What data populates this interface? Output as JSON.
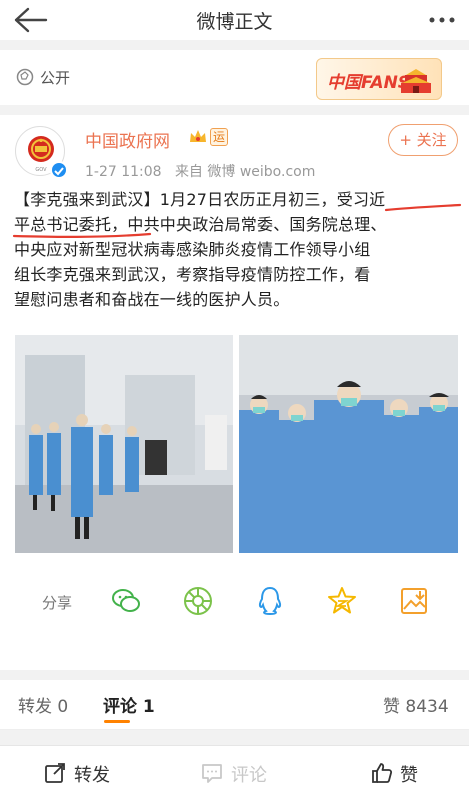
{
  "nav": {
    "title": "微博正文"
  },
  "visibility": {
    "label": "公开"
  },
  "fans_badge": {
    "text": "中国FANS"
  },
  "post": {
    "author": "中国政府网",
    "tag": "运",
    "time": "1-27 11:08",
    "source": "来自 微博 weibo.com",
    "follow_label": "+ 关注",
    "lines": [
      "【李克强来到武汉】1月27日农历正月初三，受习近",
      "平总书记委托，中共中央政治局常委、国务院总理、",
      "中央应对新型冠状病毒感染肺炎疫情工作领导小组",
      "组长李克强来到武汉，考察指导疫情防控工作，看",
      "望慰问患者和奋战在一线的医护人员。"
    ]
  },
  "share": {
    "label": "分享",
    "icons": [
      "wechat-icon",
      "moments-icon",
      "qq-icon",
      "qzone-icon",
      "save-image-icon"
    ]
  },
  "tabs": {
    "repost": "转发 0",
    "comment": "评论 1",
    "likes": "赞 8434"
  },
  "bottom": {
    "repost": "转发",
    "comment": "评论",
    "like": "赞"
  },
  "colors": {
    "accent": "#eb7350",
    "underline": "#e53d2f",
    "weibo_orange": "#ff8200"
  }
}
